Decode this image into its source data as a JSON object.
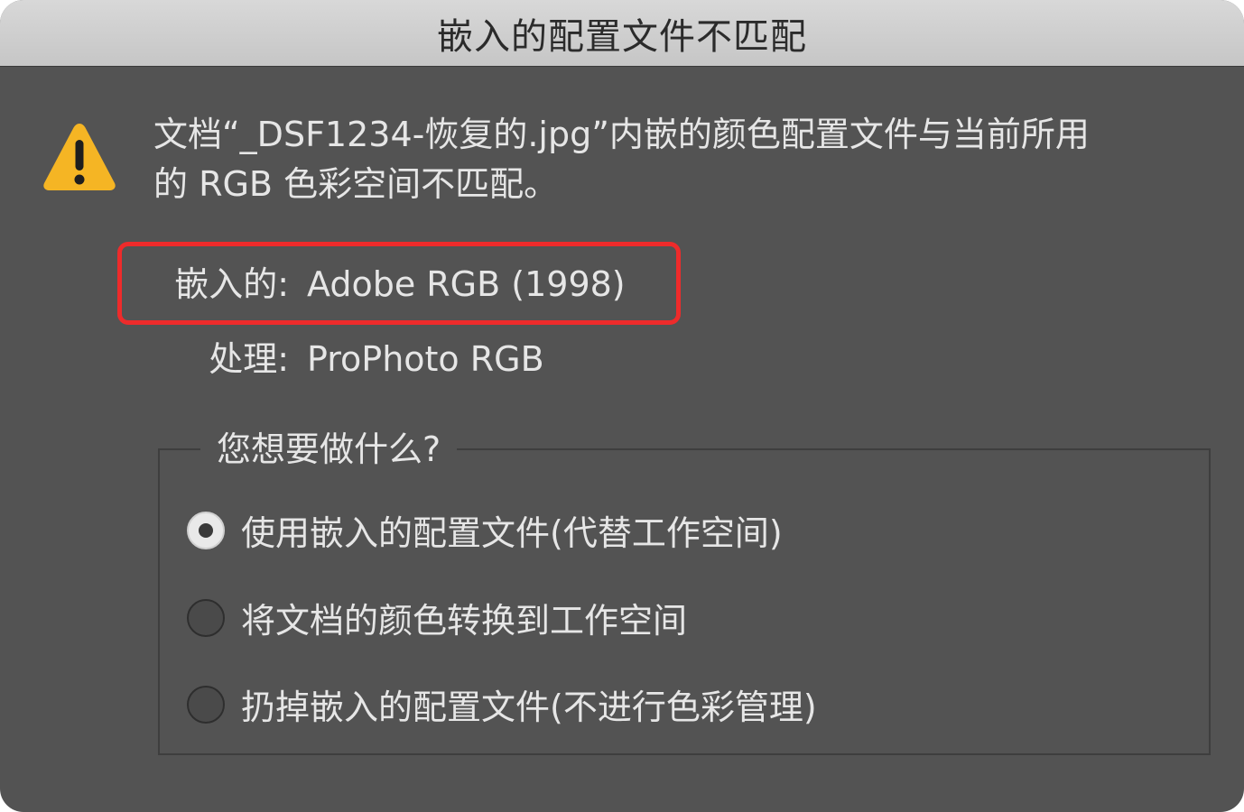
{
  "dialog": {
    "title": "嵌入的配置文件不匹配",
    "icon": "warning-triangle-icon",
    "message_line1": "文档“_DSF1234-恢复的.jpg”内嵌的颜色配置文件与当前所用",
    "message_line2": "的 RGB 色彩空间不匹配。",
    "embedded": {
      "label": "嵌入的:",
      "value": "Adobe RGB (1998)"
    },
    "working": {
      "label": "处理:",
      "value": "ProPhoto RGB"
    },
    "question": "您想要做什么?",
    "options": [
      {
        "label": "使用嵌入的配置文件(代替工作空间)",
        "selected": true
      },
      {
        "label": "将文档的颜色转换到工作空间",
        "selected": false
      },
      {
        "label": "扔掉嵌入的配置文件(不进行色彩管理)",
        "selected": false
      }
    ],
    "colors": {
      "highlight": "#ee2b2b",
      "warning": "#f5b524",
      "background": "#535353"
    }
  }
}
